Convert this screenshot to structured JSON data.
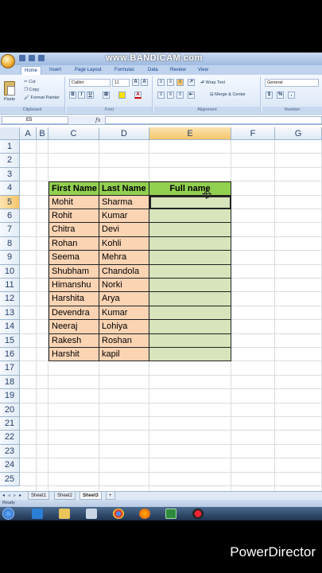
{
  "watermark": "www.BANDICAM.com",
  "ribbon": {
    "tabs": [
      "Home",
      "Insert",
      "Page Layout",
      "Formulas",
      "Data",
      "Review",
      "View"
    ],
    "clipboard": {
      "paste": "Paste",
      "cut": "Cut",
      "copy": "Copy",
      "format_painter": "Format Painter",
      "label": "Clipboard"
    },
    "font": {
      "name": "Calibri",
      "size": "11",
      "label": "Font"
    },
    "alignment": {
      "wrap": "Wrap Text",
      "merge": "Merge & Center",
      "label": "Alignment"
    },
    "number": {
      "format": "General",
      "currency": "$",
      "percent": "%",
      "label": "Number"
    }
  },
  "formula_bar": {
    "name_box": "E5",
    "fx": "fx"
  },
  "columns": [
    "A",
    "B",
    "C",
    "D",
    "E",
    "F",
    "G"
  ],
  "rows": [
    "1",
    "2",
    "3",
    "4",
    "5",
    "6",
    "7",
    "8",
    "9",
    "10",
    "11",
    "12",
    "13",
    "14",
    "15",
    "16",
    "17",
    "18",
    "19",
    "20",
    "21",
    "22",
    "23",
    "24",
    "25"
  ],
  "table": {
    "headers": [
      "First Name",
      "Last Name",
      "Full name"
    ],
    "rows": [
      [
        "Mohit",
        "Sharma"
      ],
      [
        "Rohit",
        "Kumar"
      ],
      [
        "Chitra",
        "Devi"
      ],
      [
        "Rohan",
        "Kohli"
      ],
      [
        "Seema",
        "Mehra"
      ],
      [
        "Shubham",
        "Chandola"
      ],
      [
        "Himanshu",
        "Norki"
      ],
      [
        "Harshita",
        "Arya"
      ],
      [
        "Devendra",
        "Kumar"
      ],
      [
        "Neeraj",
        "Lohiya"
      ],
      [
        "Rakesh",
        "Roshan"
      ],
      [
        "Harshit",
        "kapil"
      ]
    ]
  },
  "sheets": [
    "Sheet1",
    "Sheet2",
    "Sheet3"
  ],
  "active_sheet": "Sheet3",
  "status": "Ready",
  "brand": "PowerDirector",
  "colors": {
    "header_green": "#92d050",
    "name_peach": "#fbd4b4",
    "fullname_green": "#d7e4bc"
  }
}
